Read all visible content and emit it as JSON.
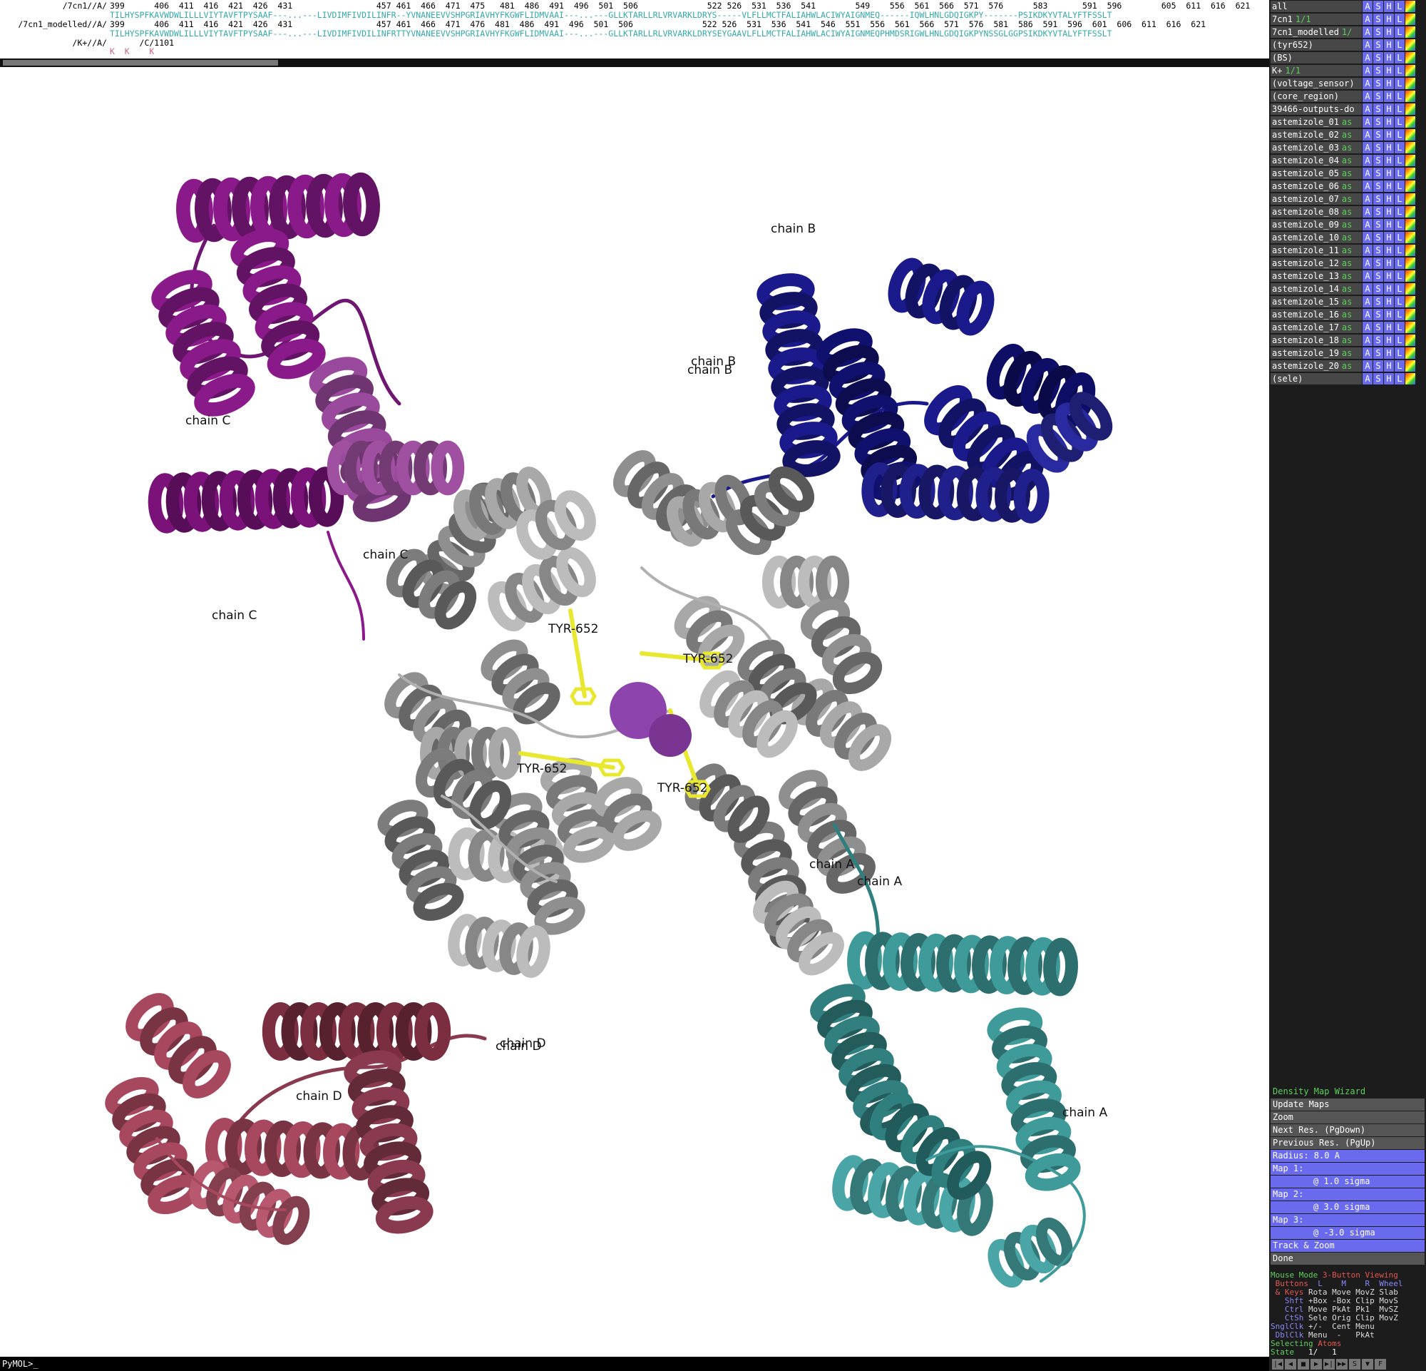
{
  "sequence_viewer": {
    "rows": [
      {
        "name": "/7cn1//A/",
        "text": "399      406  411  416  421  426  431                 457 461  466  471  475   481  486  491  496  501  506              522 526  531  536  541        549    556  561  566  571  576      583       591  596        605  611  616  621",
        "color": "black"
      },
      {
        "name": "",
        "text": "TILHYSPFKAVWDWLILLLVIYTAVFTPYSAAF---...---LIVDIMFIVDILINFR--YVNANEEVVSHPGRIAVHYFKGWFLIDMVAAI---...---GLLKTARLLRLVRVARKLDRYS-----VLFLLMCTFALIAHWLACIWYAIGNMEQ------IQWLHNLGDQIGKPY-------PSIKDKYVTALYFTFSSLT",
        "color": "teal"
      },
      {
        "name": "/7cn1_modelled//A/",
        "text": "399      406  411  416  421  426  431                 457 461  466  471  476  481  486  491  496  501  506              522 526  531  536  541  546  551  556  561  566  571  576  581  586  591  596  601  606  611  616  621",
        "color": "black"
      },
      {
        "name": "",
        "text": "TILHYSPFKAVWDWLILLLVIYTAVFTPYSAAF---...---LIVDIMFIVDILINFRTTYVNANEEVVSHPGRIAVHYFKGWFLIDMVAAI---...---GLLKTARLLRLVRVARKLDRYSEYGAAVLFLLMCTFALIAHWLACIWYAIGNMEQPHMDSRIGWLHNLGDQIGKPYNSSGLGGPSIKDKYVTALYFTFSSLT",
        "color": "teal"
      },
      {
        "name": "/K+//A/",
        "text": "      /C/1101",
        "color": "black"
      },
      {
        "name": "",
        "text": "K  K    K",
        "color": "pink"
      }
    ]
  },
  "viewport": {
    "labels": [
      {
        "text": "chain B"
      },
      {
        "text": "chain B"
      },
      {
        "text": "chain B"
      },
      {
        "text": "chain C"
      },
      {
        "text": "chain C"
      },
      {
        "text": "chain C"
      },
      {
        "text": "TYR-652"
      },
      {
        "text": "TYR-652"
      },
      {
        "text": "TYR-652"
      },
      {
        "text": "TYR-652"
      },
      {
        "text": "chain A"
      },
      {
        "text": "chain A"
      },
      {
        "text": "chain A"
      },
      {
        "text": "chain D"
      },
      {
        "text": "chain D"
      },
      {
        "text": "chain D"
      }
    ],
    "colors": {
      "chain_A": "#3f9a9a",
      "chain_B": "#1a1a8c",
      "chain_C": "#8a1a8a",
      "chain_D": "#a8485e",
      "core": "#9a9a9a",
      "ligand": "#e8e830",
      "ion": "#8e44ad"
    }
  },
  "objects": [
    {
      "name": "all",
      "state": ""
    },
    {
      "name": "7cn1",
      "state": "1/1"
    },
    {
      "name": "7cn1_modelled",
      "state": "1/"
    },
    {
      "name": "(tyr652)",
      "state": ""
    },
    {
      "name": "(BS)",
      "state": ""
    },
    {
      "name": "K+",
      "state": "1/1"
    },
    {
      "name": "(voltage_sensor)",
      "state": ""
    },
    {
      "name": "(core_region)",
      "state": ""
    },
    {
      "name": "39466-outputs-do",
      "state": ""
    },
    {
      "name": "astemizole_01",
      "state": "as"
    },
    {
      "name": "astemizole_02",
      "state": "as"
    },
    {
      "name": "astemizole_03",
      "state": "as"
    },
    {
      "name": "astemizole_04",
      "state": "as"
    },
    {
      "name": "astemizole_05",
      "state": "as"
    },
    {
      "name": "astemizole_06",
      "state": "as"
    },
    {
      "name": "astemizole_07",
      "state": "as"
    },
    {
      "name": "astemizole_08",
      "state": "as"
    },
    {
      "name": "astemizole_09",
      "state": "as"
    },
    {
      "name": "astemizole_10",
      "state": "as"
    },
    {
      "name": "astemizole_11",
      "state": "as"
    },
    {
      "name": "astemizole_12",
      "state": "as"
    },
    {
      "name": "astemizole_13",
      "state": "as"
    },
    {
      "name": "astemizole_14",
      "state": "as"
    },
    {
      "name": "astemizole_15",
      "state": "as"
    },
    {
      "name": "astemizole_16",
      "state": "as"
    },
    {
      "name": "astemizole_17",
      "state": "as"
    },
    {
      "name": "astemizole_18",
      "state": "as"
    },
    {
      "name": "astemizole_19",
      "state": "as"
    },
    {
      "name": "astemizole_20",
      "state": "as"
    },
    {
      "name": "(sele)",
      "state": ""
    }
  ],
  "object_buttons": [
    "A",
    "S",
    "H",
    "L"
  ],
  "wizard": {
    "title": "Density Map Wizard",
    "update": "Update Maps",
    "zoom": "Zoom",
    "next": "Next Res. (PgDown)",
    "prev": "Previous Res. (PgUp)",
    "radius": "Radius: 8.0 A",
    "map1": "Map 1:",
    "map1_sigma": "@ 1.0 sigma",
    "map2": "Map 2:",
    "map2_sigma": "@ 3.0 sigma",
    "map3": "Map 3:",
    "map3_sigma": "@ -3.0 sigma",
    "track": "Track & Zoom",
    "done": "Done"
  },
  "mouse_mode": {
    "title": "Mouse Mode",
    "mode": "3-Button Viewing",
    "rows": [
      {
        "label": " Buttons",
        "text": "  L    M    R  Wheel"
      },
      {
        "label": " & Keys",
        "text": " Rota Move MovZ Slab"
      },
      {
        "label": "   Shft",
        "text": " +Box -Box Clip MovS"
      },
      {
        "label": "   Ctrl",
        "text": " Move PkAt Pk1  MvSZ"
      },
      {
        "label": "   CtSh",
        "text": " Sele Orig Clip MovZ"
      },
      {
        "label": "SnglClk",
        "text": " +/-  Cent Menu"
      },
      {
        "label": " DblClk",
        "text": " Menu  -   PkAt"
      }
    ],
    "selecting": "Selecting",
    "selecting_value": "Atoms",
    "state": "State",
    "state_value": "   1/   1"
  },
  "command_line": "PyMOL>_"
}
